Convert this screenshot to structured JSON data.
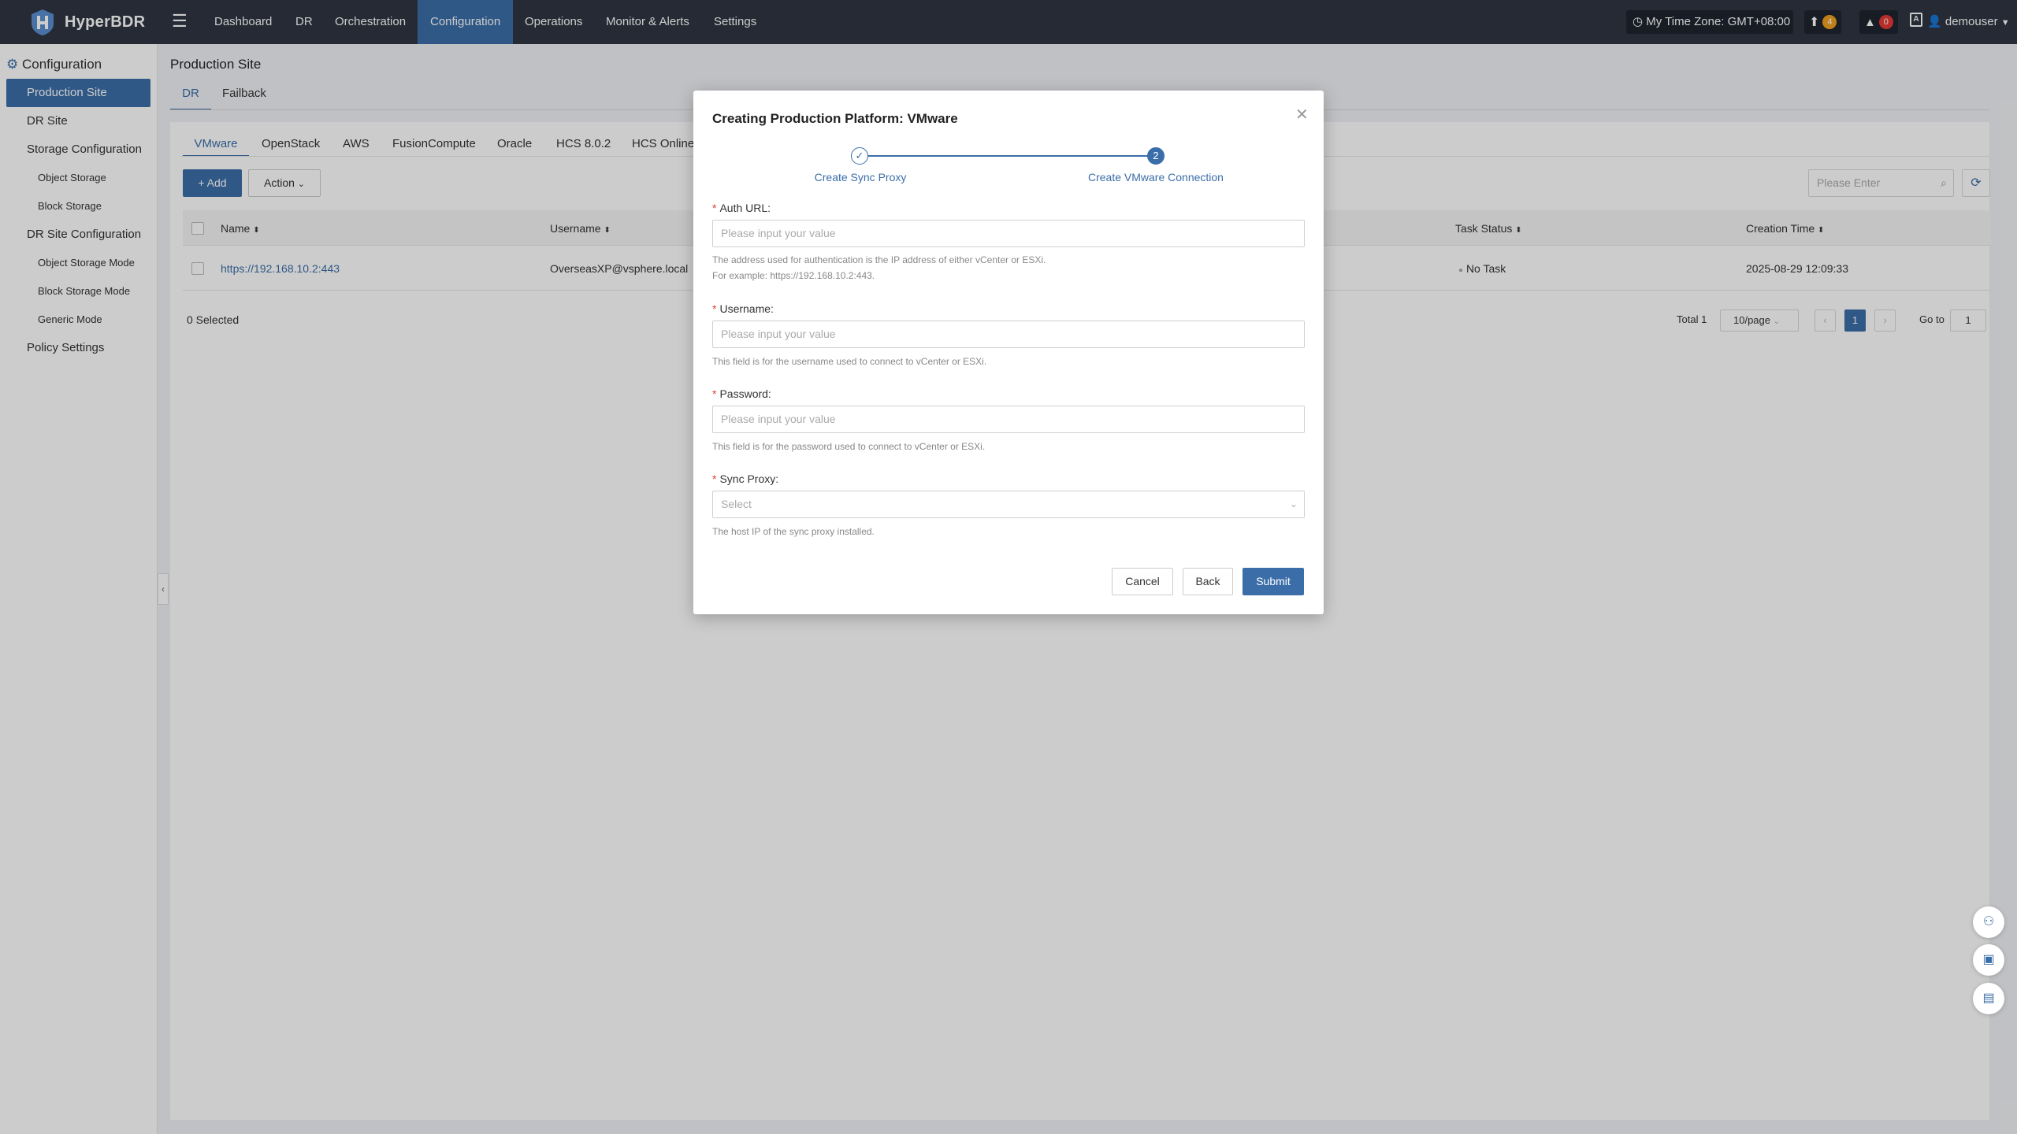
{
  "app": {
    "name": "HyperBDR"
  },
  "topnav": {
    "items": [
      "Dashboard",
      "DR",
      "Orchestration",
      "Configuration",
      "Operations",
      "Monitor & Alerts",
      "Settings"
    ],
    "active": "Configuration",
    "timezone": "My Time Zone: GMT+08:00",
    "upgrade_count": "4",
    "alert_count": "0",
    "user": "demouser"
  },
  "sidebar": {
    "section": "Configuration",
    "items": [
      {
        "label": "Production Site"
      },
      {
        "label": "DR Site"
      },
      {
        "label": "Storage Configuration"
      },
      {
        "label": "Object Storage"
      },
      {
        "label": "Block Storage"
      },
      {
        "label": "DR Site Configuration"
      },
      {
        "label": "Object Storage Mode"
      },
      {
        "label": "Block Storage Mode"
      },
      {
        "label": "Generic Mode"
      },
      {
        "label": "Policy Settings"
      }
    ]
  },
  "page": {
    "title": "Production Site",
    "tabs": [
      "DR",
      "Failback"
    ],
    "platform_tabs": [
      "VMware",
      "OpenStack",
      "AWS",
      "FusionCompute",
      "Oracle",
      "HCS 8.0.2",
      "HCS Online"
    ],
    "add_label": "+ Add",
    "action_label": "Action",
    "search_placeholder": "Please Enter"
  },
  "table": {
    "columns": [
      "Name",
      "Username",
      "Task Status",
      "Creation Time"
    ],
    "rows": [
      {
        "name": "https://192.168.10.2:443",
        "username": "OverseasXP@vsphere.local",
        "task_status": "No Task",
        "creation_time": "2025-08-29 12:09:33"
      }
    ],
    "selected": "0 Selected",
    "total": "Total 1",
    "page_size": "10/page",
    "current_page": "1",
    "goto_label": "Go to",
    "goto_value": "1"
  },
  "modal": {
    "title": "Creating Production Platform: VMware",
    "steps": [
      {
        "label": "Create Sync Proxy",
        "status": "done"
      },
      {
        "label": "Create VMware Connection",
        "number": "2",
        "status": "active"
      }
    ],
    "fields": {
      "auth_url": {
        "label": "Auth URL:",
        "placeholder": "Please input your value",
        "hint1": "The address used for authentication is the IP address of either vCenter or ESXi.",
        "hint2": "For example: https://192.168.10.2:443."
      },
      "username": {
        "label": "Username:",
        "placeholder": "Please input your value",
        "hint": "This field is for the username used to connect to vCenter or ESXi."
      },
      "password": {
        "label": "Password:",
        "placeholder": "Please input your value",
        "hint": "This field is for the password used to connect to vCenter or ESXi."
      },
      "sync_proxy": {
        "label": "Sync Proxy:",
        "placeholder": "Select",
        "hint": "The host IP of the sync proxy installed."
      }
    },
    "buttons": {
      "cancel": "Cancel",
      "back": "Back",
      "submit": "Submit"
    }
  },
  "colors": {
    "primary": "#3b6ea8",
    "nav_bg": "#2f3542",
    "required": "#e53935"
  }
}
